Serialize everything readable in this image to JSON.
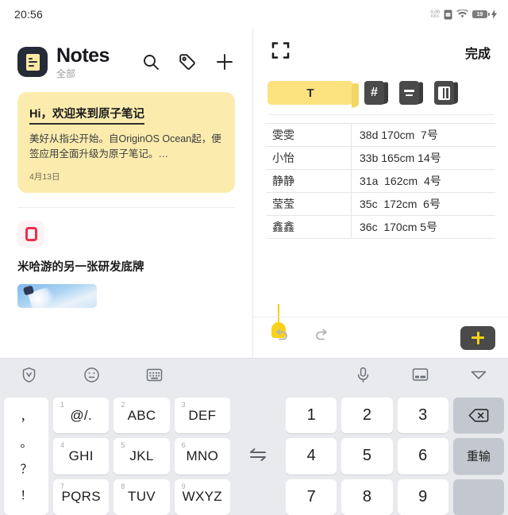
{
  "statusbar": {
    "time": "20:56",
    "netspeed_value": "0.00",
    "netspeed_unit": "KB/s",
    "battery_level": "19"
  },
  "notes_panel": {
    "app_title": "Notes",
    "app_subtitle": "全部",
    "actions": [
      {
        "name": "search-icon",
        "label": "搜索"
      },
      {
        "name": "tag-icon",
        "label": "标签"
      },
      {
        "name": "add-icon",
        "label": "新建"
      }
    ],
    "note_card": {
      "title": "Hi，欢迎来到原子笔记",
      "body": "美好从指尖开始。自OriginOS Ocean起，便签应用全面升级为原子笔记。…",
      "date": "4月13日"
    },
    "second_item": {
      "title": "米哈游的另一张研发底牌"
    }
  },
  "editor_panel": {
    "fullscreen_label": "全屏",
    "done_label": "完成",
    "format_tools": [
      {
        "name": "text-style",
        "label": "T"
      },
      {
        "name": "heading",
        "label": "#"
      },
      {
        "name": "list-align",
        "label": ""
      },
      {
        "name": "table",
        "label": ""
      }
    ],
    "table": {
      "rows": [
        {
          "name": "雯雯",
          "value": "38d 170cm  7号"
        },
        {
          "name": "小怡",
          "value": "33b 165cm 14号"
        },
        {
          "name": "静静",
          "value": "31a  162cm  4号"
        },
        {
          "name": "莹莹",
          "value": "35c  172cm  6号"
        },
        {
          "name": "鑫鑫",
          "value": "36c  170cm 5号"
        }
      ]
    },
    "bottom_bar": {
      "undo_label": "撤销",
      "redo_label": "重做",
      "add_label": "+"
    },
    "accent_color": "#f8d21a"
  },
  "keyboard": {
    "toolbar": [
      {
        "name": "shield-v-icon",
        "label": "安全"
      },
      {
        "name": "emoji-icon",
        "label": "表情"
      },
      {
        "name": "keyboard-settings-icon",
        "label": "设置"
      },
      {
        "name": "microphone-icon",
        "label": "语音"
      },
      {
        "name": "keyboard-layout-icon",
        "label": "键盘"
      },
      {
        "name": "collapse-keyboard-icon",
        "label": "收起"
      }
    ],
    "punctuation": [
      "，",
      "。",
      "？",
      "！"
    ],
    "t9_keys": [
      {
        "num": "1",
        "letters": "@/."
      },
      {
        "num": "2",
        "letters": "ABC"
      },
      {
        "num": "3",
        "letters": "DEF"
      },
      {
        "num": "4",
        "letters": "GHI"
      },
      {
        "num": "5",
        "letters": "JKL"
      },
      {
        "num": "6",
        "letters": "MNO"
      },
      {
        "num": "7",
        "letters": "PQRS"
      },
      {
        "num": "8",
        "letters": "TUV"
      },
      {
        "num": "9",
        "letters": "WXYZ"
      }
    ],
    "swap_label": "切换",
    "numeric_keys": [
      "1",
      "2",
      "3",
      "4",
      "5",
      "6",
      "7",
      "8",
      "9"
    ],
    "backspace_label": "",
    "retype_label": "重输"
  }
}
